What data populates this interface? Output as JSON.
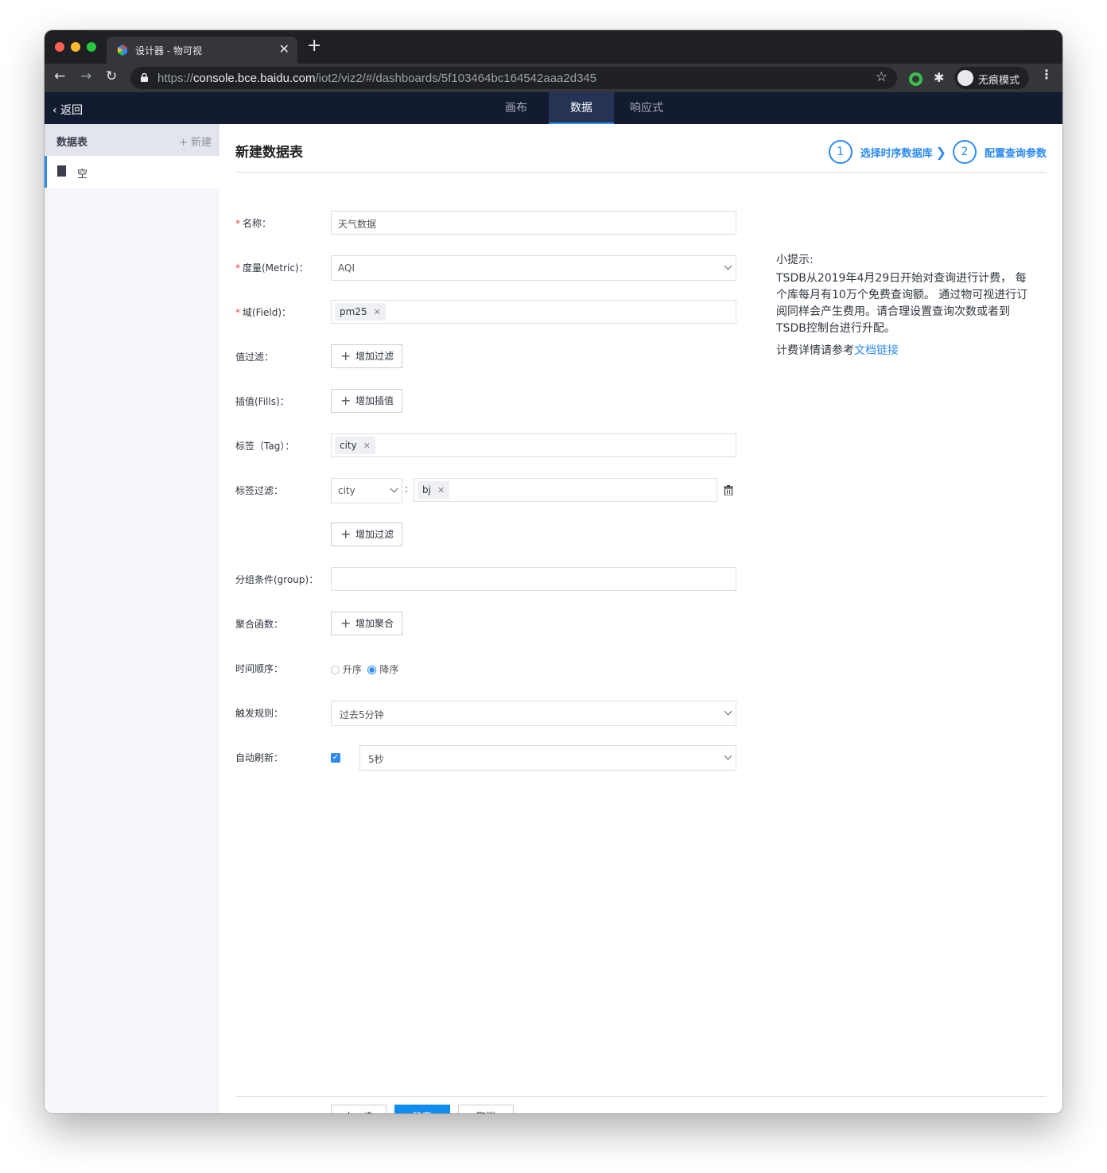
{
  "browser": {
    "tab_title": "设计器 - 物可视",
    "url_scheme": "https://",
    "url_host": "console.bce.baidu.com",
    "url_path": "/iot2/viz2/#/dashboards/5f103464bc164542aaa2d345",
    "incognito_label": "无痕模式"
  },
  "appbar": {
    "back_label": "返回",
    "tabs": [
      {
        "label": "画布",
        "active": false
      },
      {
        "label": "数据",
        "active": true
      },
      {
        "label": "响应式",
        "active": false
      }
    ]
  },
  "sidebar": {
    "title": "数据表",
    "new_label": "+ 新建",
    "items": [
      {
        "label": "空"
      }
    ]
  },
  "main": {
    "title": "新建数据表",
    "steps": [
      {
        "num": "1",
        "label": "选择时序数据库"
      },
      {
        "num": "2",
        "label": "配置查询参数"
      }
    ]
  },
  "form": {
    "name_label": "名称：",
    "name_value": "天气数据",
    "metric_label": "度量(Metric)：",
    "metric_value": "AQI",
    "field_label": "域(Field)：",
    "field_chips": [
      "pm25"
    ],
    "value_filter_label": "值过滤：",
    "add_filter_label": "增加过滤",
    "fills_label": "插值(Fills)：",
    "add_fill_label": "增加插值",
    "tag_label": "标签（Tag）：",
    "tag_chips": [
      "city"
    ],
    "tag_filter_label": "标签过滤：",
    "tag_filter_key": "city",
    "tag_filter_values": [
      "bj"
    ],
    "tag_filter_sep": ":",
    "add_tag_filter_label": "增加过滤",
    "group_label": "分组条件(group)：",
    "group_value": "",
    "agg_label": "聚合函数：",
    "add_agg_label": "增加聚合",
    "order_label": "时间顺序：",
    "order_asc": "升序",
    "order_desc": "降序",
    "order_selected": "降序",
    "trigger_label": "触发规则：",
    "trigger_value": "过去5分钟",
    "refresh_label": "自动刷新：",
    "refresh_enabled": true,
    "refresh_value": "5秒"
  },
  "tips": {
    "title": "小提示:",
    "body": "TSDB从2019年4月29日开始对查询进行计费， 每个库每月有10万个免费查询额。 通过物可视进行订阅同样会产生费用。请合理设置查询次数或者到TSDB控制台进行升配。",
    "doc_prefix": "计费详情请参考",
    "doc_link": "文档链接"
  },
  "footer": {
    "prev_label": "上一步",
    "confirm_label": "确定",
    "cancel_label": "取消"
  },
  "colors": {
    "accent": "#2d8cf0",
    "appbar_bg": "#121b30",
    "required": "#e8403a"
  }
}
